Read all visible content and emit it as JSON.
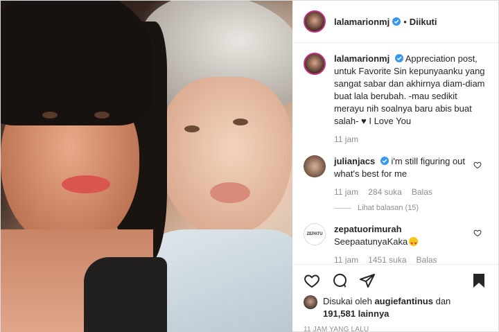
{
  "post": {
    "username": "lalamarionmj",
    "dot": "•",
    "follow_status": "Diikuti",
    "caption_user": "lalamarionmj",
    "caption_text": "Appreciation post, untuk Favorite Sin kepunyaanku yang sangat sabar dan akhirnya diam-diam buat lala berubah. -mau sedikit merayu nih soalnya baru abis buat salah- ♥ I Love You",
    "caption_time": "11 jam"
  },
  "comments": [
    {
      "user": "julianjacs",
      "text": "i'm still figuring out what's best for me",
      "time": "11 jam",
      "likes": "284 suka",
      "reply": "Balas",
      "view_replies": "Lihat balasan (15)"
    },
    {
      "user": "zepatuorimurah",
      "avatar_text": "ZEPATU",
      "text": "SeepaatunyaKaka",
      "time": "11 jam",
      "likes": "1451 suka",
      "reply": "Balas"
    }
  ],
  "likes": {
    "prefix": "Disukai oleh",
    "user": "augiefantinus",
    "middle": "dan",
    "count": "191,581 lainnya"
  },
  "timestamp": "11 JAM YANG LALU",
  "colors": {
    "verified": "#3897f0",
    "text": "#262626",
    "muted": "#8e8e8e",
    "story_ring": "#c13584"
  },
  "icons": [
    "heart-icon",
    "comment-icon",
    "share-icon",
    "bookmark-icon",
    "verified-icon"
  ]
}
